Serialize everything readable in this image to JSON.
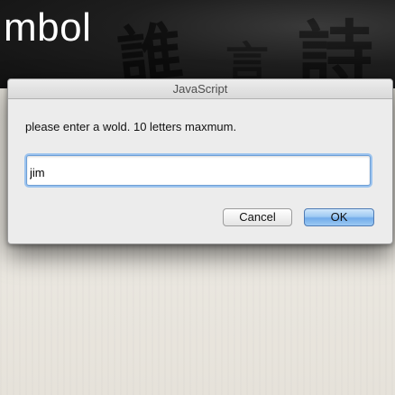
{
  "background": {
    "page_title": "mbol",
    "glyphs": [
      "誰",
      "詩",
      "言"
    ]
  },
  "dialog": {
    "title": "JavaScript",
    "message": "please enter a wold. 10 letters maxmum.",
    "input_value": "jim",
    "cancel_label": "Cancel",
    "ok_label": "OK"
  }
}
